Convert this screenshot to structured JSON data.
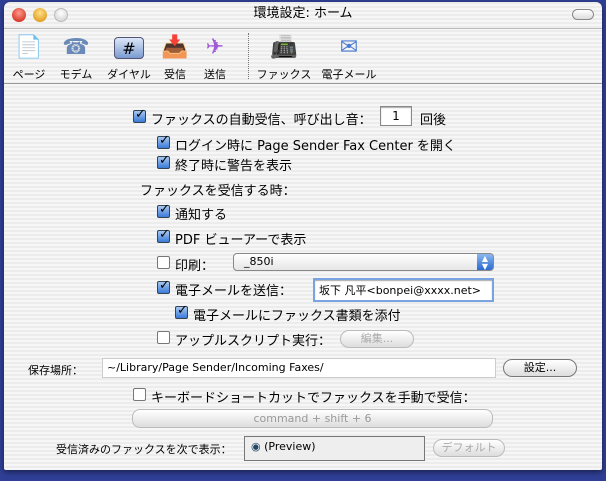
{
  "window": {
    "title": "環境設定: ホーム"
  },
  "toolbar": {
    "items": [
      {
        "label": "ページ",
        "icon": "page-icon"
      },
      {
        "label": "モデム",
        "icon": "phone-icon"
      },
      {
        "label": "ダイヤル",
        "icon": "hash-icon"
      },
      {
        "label": "受信",
        "icon": "inbox-icon"
      },
      {
        "label": "送信",
        "icon": "paper-plane-icon"
      },
      {
        "label": "ファックス",
        "icon": "fax-icon"
      },
      {
        "label": "電子メール",
        "icon": "envelope-icon"
      }
    ]
  },
  "auto_receive": {
    "label": "ファックスの自動受信、呼び出し音：",
    "rings": "1",
    "suffix": "回後",
    "checked": true
  },
  "open_on_login": {
    "label": "ログイン時に Page Sender Fax Center を開く",
    "checked": true
  },
  "warn_on_quit": {
    "label": "終了時に警告を表示",
    "checked": true
  },
  "on_receive_label": "ファックスを受信する時：",
  "notify": {
    "label": "通知する",
    "checked": true
  },
  "pdf_view": {
    "label": "PDF ビューアーで表示",
    "checked": true
  },
  "print": {
    "label": "印刷：",
    "checked": false,
    "printer": "_850i"
  },
  "email": {
    "label": "電子メールを送信：",
    "checked": true,
    "address": "坂下 凡平<bonpei@xxxx.net>"
  },
  "attach": {
    "label": "電子メールにファックス書類を添付",
    "checked": true
  },
  "applescript": {
    "label": "アップルスクリプト実行：",
    "checked": false,
    "edit_button": "編集..."
  },
  "save_location": {
    "label": "保存場所：",
    "path": "~/Library/Page Sender/Incoming Faxes/",
    "set_button": "設定..."
  },
  "shortcut": {
    "label": "キーボードショートカットでファックスを手動で受信：",
    "checked": false,
    "keys": "command + shift + 6"
  },
  "viewer": {
    "label": "受信済みのファックスを次で表示：",
    "app": "(Preview)",
    "default_button": "デフォルト"
  }
}
